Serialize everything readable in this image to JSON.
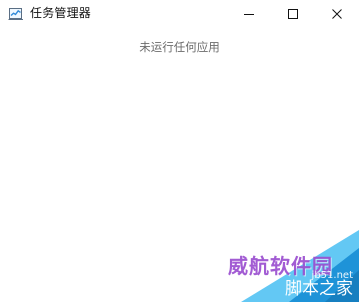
{
  "window": {
    "title": "任务管理器",
    "app_icon": "task-manager-icon",
    "buttons": {
      "minimize_icon": "minimize-icon",
      "maximize_icon": "maximize-icon",
      "close_icon": "close-icon"
    }
  },
  "content": {
    "empty_message": "未运行任何应用"
  },
  "watermark": {
    "brand": "威航软件园",
    "url": "jb51.net",
    "site": "脚本之家",
    "colors": {
      "brand": "#9b4fd0",
      "corner_light": "#63c8f4",
      "corner_dark": "#1e93d8"
    }
  }
}
